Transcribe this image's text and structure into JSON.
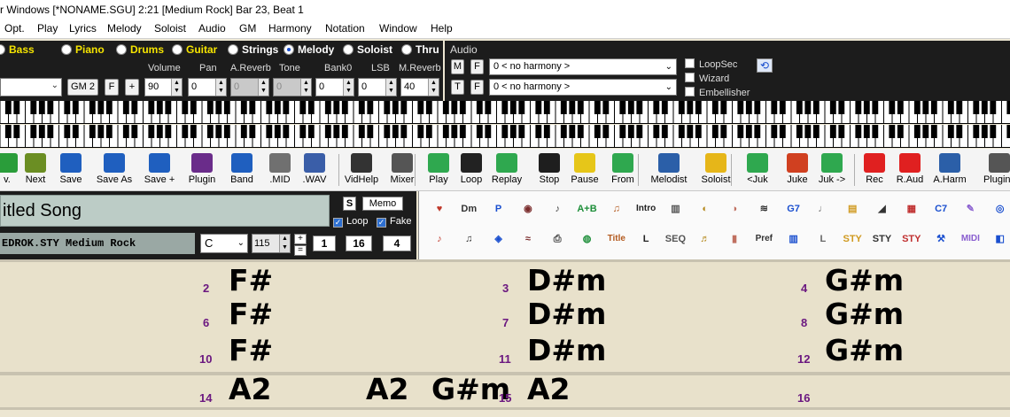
{
  "window": {
    "title": "r Windows  [*NONAME.SGU]   2:21  [Medium Rock]  Bar 23, Beat 1"
  },
  "menu": [
    "Opt.",
    "Play",
    "Lyrics",
    "Melody",
    "Soloist",
    "Audio",
    "GM",
    "Harmony",
    "Notation",
    "Window",
    "Help"
  ],
  "parts": [
    {
      "label": "Bass",
      "selected": false,
      "color": "#f5e400"
    },
    {
      "label": "Piano",
      "selected": false,
      "color": "#f5e400"
    },
    {
      "label": "Drums",
      "selected": false,
      "color": "#f5e400"
    },
    {
      "label": "Guitar",
      "selected": false,
      "color": "#f5e400"
    },
    {
      "label": "Strings",
      "selected": false,
      "color": "#ffffff"
    },
    {
      "label": "Melody",
      "selected": true,
      "color": "#ffffff"
    },
    {
      "label": "Soloist",
      "selected": false,
      "color": "#ffffff"
    },
    {
      "label": "Thru",
      "selected": false,
      "color": "#ffffff"
    }
  ],
  "mixer": {
    "headers": [
      "Volume",
      "Pan",
      "A.Reverb",
      "Tone",
      "Bank0",
      "LSB",
      "M.Reverb"
    ],
    "gm_button": "GM 2",
    "f_button": "F",
    "plus_button": "+",
    "volume": "90",
    "pan": "0",
    "areverb": "0",
    "tone": "0",
    "bank0": "0",
    "lsb": "0",
    "mreverb": "40"
  },
  "audio": {
    "title": "Audio",
    "m_button": "M",
    "f_button": "F",
    "t_button": "T",
    "f2_button": "F",
    "harmony1": "0 < no harmony >",
    "harmony2": "0 < no harmony >",
    "loopsec": "LoopSec",
    "wizard": "Wizard",
    "embellisher": "Embellisher"
  },
  "toolbar": [
    {
      "label": "v.",
      "icon": "prev-icon",
      "color": "#2a9d3a"
    },
    {
      "label": "Next",
      "icon": "next-icon",
      "color": "#6b8e23"
    },
    {
      "label": "Save",
      "icon": "save-icon",
      "color": "#1f5fbf"
    },
    {
      "label": "Save As",
      "icon": "save-as-icon",
      "color": "#1f5fbf"
    },
    {
      "label": "Save +",
      "icon": "save-plus-icon",
      "color": "#1f5fbf"
    },
    {
      "label": "Plugin",
      "icon": "daw-plugin-icon",
      "color": "#6a2c8a"
    },
    {
      "label": "Band",
      "icon": "sty-band-icon",
      "color": "#1f5fbf"
    },
    {
      "label": ".MID",
      "icon": "midi-file-icon",
      "color": "#707070"
    },
    {
      "label": ".WAV",
      "icon": "wav-file-icon",
      "color": "#3a5ea8"
    },
    {
      "label": "VidHelp",
      "icon": "film-icon",
      "color": "#333333"
    },
    {
      "label": "Mixer",
      "icon": "mixer-icon",
      "color": "#555555"
    },
    {
      "label": "Play",
      "icon": "play-icon",
      "color": "#2fa84f"
    },
    {
      "label": "Loop",
      "icon": "loop-icon",
      "color": "#222222"
    },
    {
      "label": "Replay",
      "icon": "replay-icon",
      "color": "#2fa84f"
    },
    {
      "label": "Stop",
      "icon": "stop-icon",
      "color": "#1e1e1e"
    },
    {
      "label": "Pause",
      "icon": "pause-icon",
      "color": "#e6c619"
    },
    {
      "label": "From",
      "icon": "from-icon",
      "color": "#2fa84f"
    },
    {
      "label": "Melodist",
      "icon": "melodist-icon",
      "color": "#2b5fa8"
    },
    {
      "label": "Soloist",
      "icon": "soloist-icon",
      "color": "#e6b619"
    },
    {
      "label": "<Juk",
      "icon": "juke-prev-icon",
      "color": "#2fa84f"
    },
    {
      "label": "Juke",
      "icon": "jukebox-icon",
      "color": "#d04020"
    },
    {
      "label": "Juk ->",
      "icon": "juke-next-icon",
      "color": "#2fa84f"
    },
    {
      "label": "Rec",
      "icon": "record-icon",
      "color": "#e02020"
    },
    {
      "label": "R.Aud",
      "icon": "record-audio-icon",
      "color": "#e02020"
    },
    {
      "label": "A.Harm",
      "icon": "audio-harmony-icon",
      "color": "#2b5fa8"
    },
    {
      "label": "Plugins",
      "icon": "plugins-icon",
      "color": "#555555"
    }
  ],
  "song": {
    "title": "itled Song",
    "style": "EDROK.STY  Medium Rock",
    "key": "C",
    "tempo": "115",
    "s_button": "S",
    "memo_button": "Memo",
    "loop_label": "Loop",
    "fake_label": "Fake",
    "start_bar": "1",
    "end_bar": "16",
    "choruses": "4",
    "plus": "+",
    "minus": "="
  },
  "icon_grid": {
    "row1": [
      {
        "name": "heart-chord-icon",
        "text": "♥"
      },
      {
        "name": "chord-dm-icon",
        "text": "Dm"
      },
      {
        "name": "p-icon",
        "text": "P"
      },
      {
        "name": "audio-disc-icon",
        "text": "◉"
      },
      {
        "name": "sax-icon",
        "text": "♪"
      },
      {
        "name": "a-plus-b-icon",
        "text": "A+B"
      },
      {
        "name": "guitar-icon",
        "text": "♫"
      },
      {
        "name": "intro-icon",
        "text": "Intro"
      },
      {
        "name": "keyboard-icon",
        "text": "▥"
      },
      {
        "name": "horn-icon",
        "text": "◐"
      },
      {
        "name": "ear-icon",
        "text": "◑"
      },
      {
        "name": "waveform-icon",
        "text": "≋"
      },
      {
        "name": "notes-g7-icon",
        "text": "G7"
      },
      {
        "name": "music-pen-icon",
        "text": "♩"
      },
      {
        "name": "notebook-icon",
        "text": "▤"
      },
      {
        "name": "silhouette-icon",
        "text": "◢"
      },
      {
        "name": "fretboard-icon",
        "text": "▦"
      },
      {
        "name": "chord-c7-icon",
        "text": "C7"
      },
      {
        "name": "compass-icon",
        "text": "✎"
      },
      {
        "name": "globe-icon",
        "text": "◎"
      }
    ],
    "row2": [
      {
        "name": "eighth-note-icon",
        "text": "♪"
      },
      {
        "name": "green-note-icon",
        "text": "♫"
      },
      {
        "name": "speaker-icon",
        "text": "◈"
      },
      {
        "name": "audio-edit-icon",
        "text": "≈"
      },
      {
        "name": "printer-icon",
        "text": "⎙"
      },
      {
        "name": "drum-icon",
        "text": "◍"
      },
      {
        "name": "title-icon",
        "text": "Title"
      },
      {
        "name": "lyric-l-icon",
        "text": "L"
      },
      {
        "name": "seq-icon",
        "text": "SEQ"
      },
      {
        "name": "guitarist-icon",
        "text": "♬"
      },
      {
        "name": "fader-icon",
        "text": "▮"
      },
      {
        "name": "pref-icon",
        "text": "Pref"
      },
      {
        "name": "meter-icon",
        "text": "▥"
      },
      {
        "name": "l-box-icon",
        "text": "L"
      },
      {
        "name": "sty-disc-icon",
        "text": "STY"
      },
      {
        "name": "sty-red-icon",
        "text": "STY"
      },
      {
        "name": "sty-list-icon",
        "text": "STY"
      },
      {
        "name": "tools-icon",
        "text": "⚒"
      },
      {
        "name": "midi-icon",
        "text": "MIDI"
      },
      {
        "name": "extra-icon",
        "text": "◧"
      }
    ]
  },
  "chord_sheet": {
    "rows": [
      {
        "cells": [
          {
            "bar": "2",
            "chord": "F#"
          },
          {
            "bar": "3",
            "chord": "D#m"
          },
          {
            "bar": "4",
            "chord": "G#m"
          }
        ]
      },
      {
        "cells": [
          {
            "bar": "6",
            "chord": "F#"
          },
          {
            "bar": "7",
            "chord": "D#m"
          },
          {
            "bar": "8",
            "chord": "G#m"
          }
        ]
      },
      {
        "cells": [
          {
            "bar": "10",
            "chord": "F#"
          },
          {
            "bar": "11",
            "chord": "D#m"
          },
          {
            "bar": "12",
            "chord": "G#m"
          }
        ]
      }
    ],
    "last_row": {
      "bar14": "14",
      "chord14a": "A2",
      "chord14b": "A2",
      "chord14c": "G#m",
      "bar15": "15",
      "chord15": "A2",
      "bar16": "16"
    }
  }
}
